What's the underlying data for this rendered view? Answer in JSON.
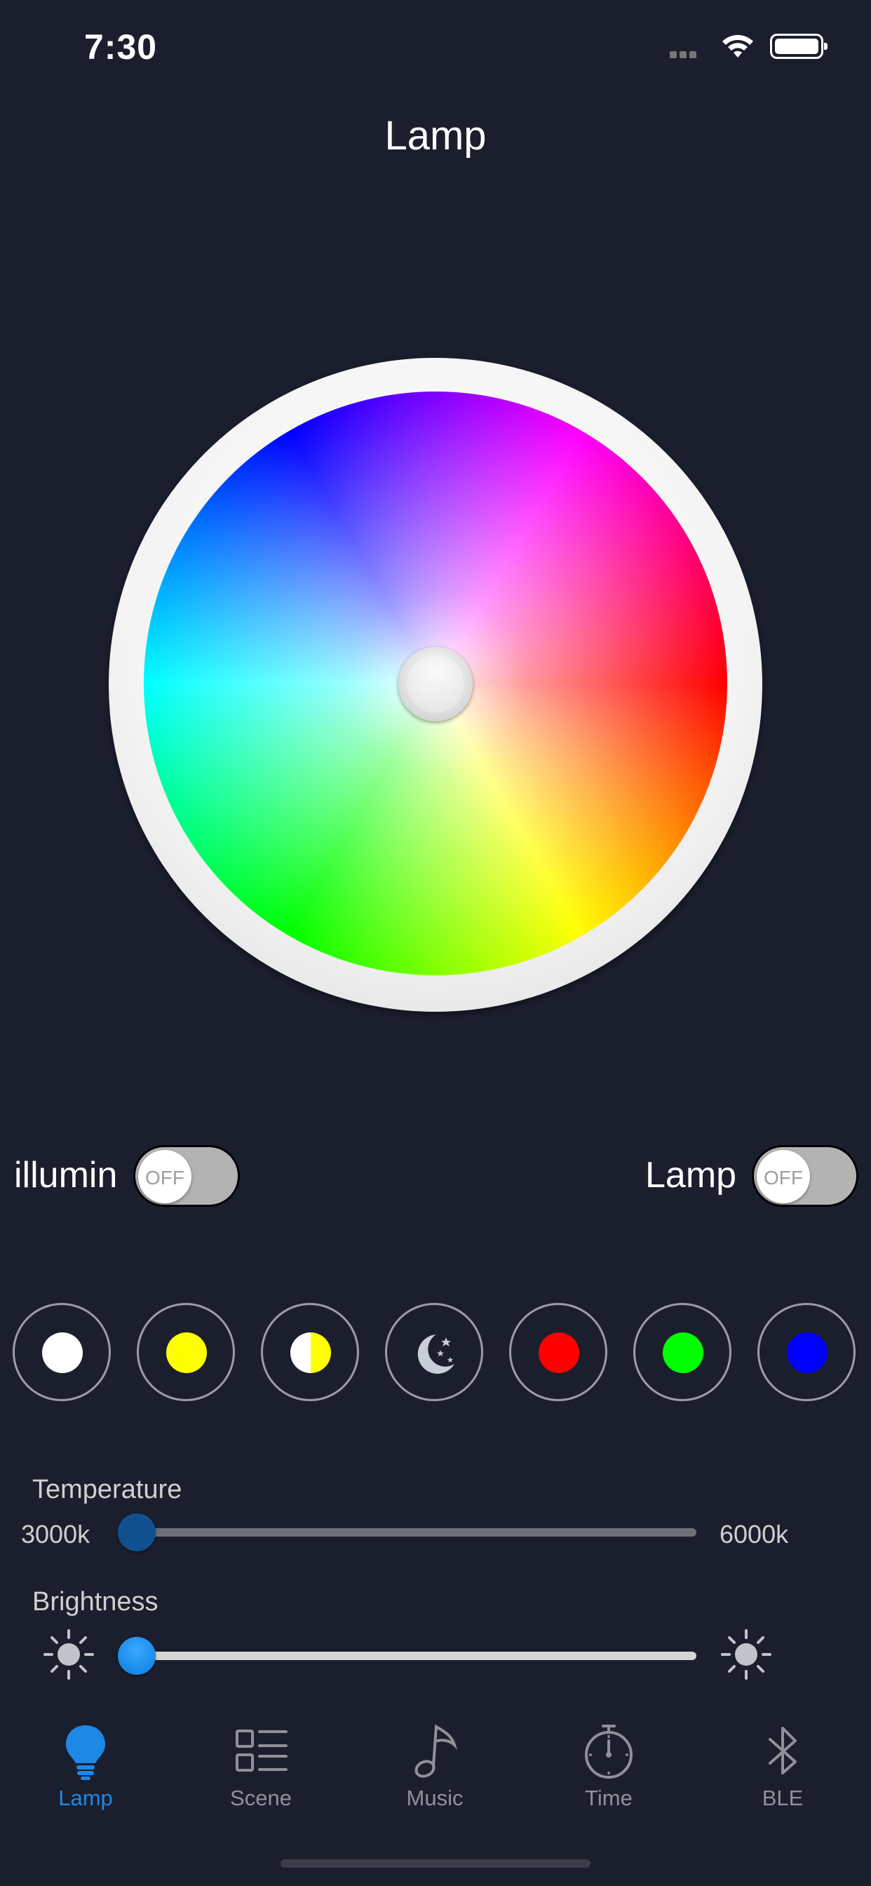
{
  "status_bar": {
    "time": "7:30"
  },
  "header": {
    "title": "Lamp"
  },
  "switches": {
    "illumin": {
      "label": "illumin",
      "state": "OFF"
    },
    "lamp": {
      "label": "Lamp",
      "state": "OFF"
    }
  },
  "presets": [
    {
      "name": "white",
      "color": "#ffffff"
    },
    {
      "name": "yellow",
      "color": "#ffff00"
    },
    {
      "name": "half-white-yellow",
      "color": "#ffff00"
    },
    {
      "name": "night-moon",
      "color": "#c9cdd8"
    },
    {
      "name": "red",
      "color": "#ff0000"
    },
    {
      "name": "green",
      "color": "#00ff00"
    },
    {
      "name": "blue",
      "color": "#0000ff"
    }
  ],
  "temperature": {
    "label": "Temperature",
    "min_label": "3000k",
    "max_label": "6000k",
    "value_fraction": 0.0
  },
  "brightness": {
    "label": "Brightness",
    "value_fraction": 0.0
  },
  "tabs": [
    {
      "label": "Lamp",
      "icon": "bulb-icon",
      "active": true
    },
    {
      "label": "Scene",
      "icon": "list-icon",
      "active": false
    },
    {
      "label": "Music",
      "icon": "music-note-icon",
      "active": false
    },
    {
      "label": "Time",
      "icon": "stopwatch-icon",
      "active": false
    },
    {
      "label": "BLE",
      "icon": "bluetooth-icon",
      "active": false
    }
  ],
  "colors": {
    "background": "#1b1e2d",
    "accent": "#1e88e5",
    "tab_inactive": "#8f9199"
  }
}
